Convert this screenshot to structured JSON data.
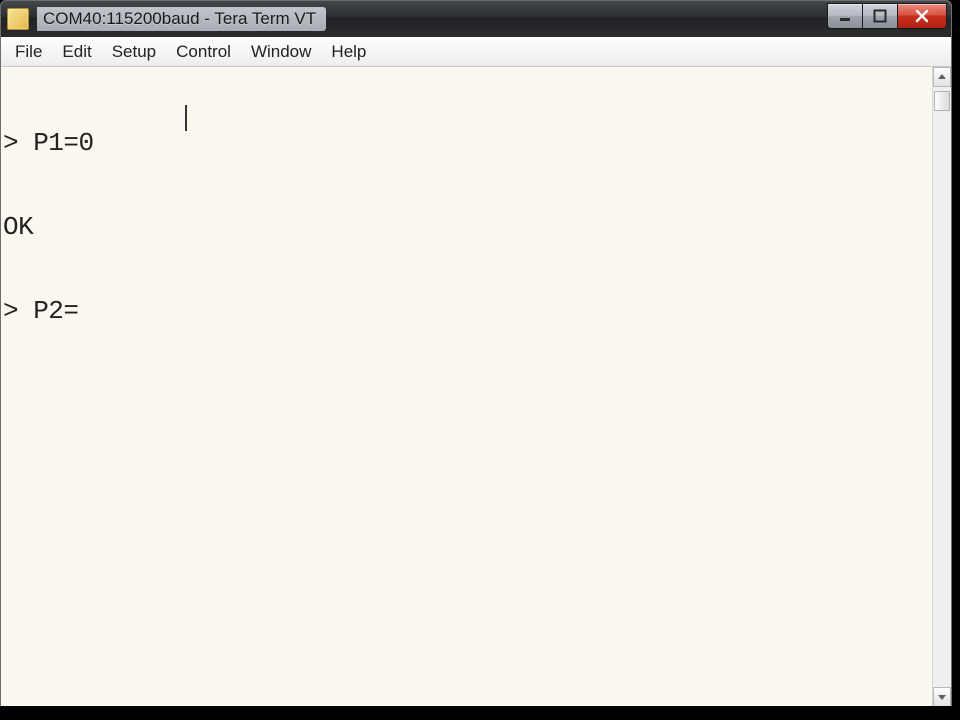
{
  "window": {
    "title": "COM40:115200baud - Tera Term VT"
  },
  "menu": {
    "items": [
      "File",
      "Edit",
      "Setup",
      "Control",
      "Window",
      "Help"
    ]
  },
  "terminal": {
    "lines": [
      "> P1=0",
      "OK",
      "> P2="
    ]
  }
}
